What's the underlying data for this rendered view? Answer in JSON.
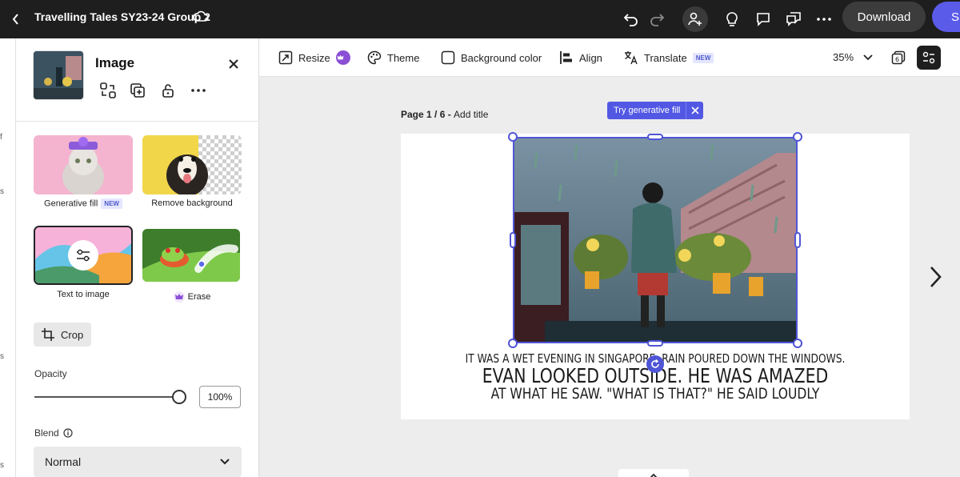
{
  "topbar": {
    "title": "Travelling Tales SY23-24 Group 2",
    "download_label": "Download",
    "share_label": "Share",
    "icons": [
      "back-icon",
      "cloud-icon",
      "undo-icon",
      "redo-icon",
      "add-person-icon",
      "lightbulb-icon",
      "comment-icon",
      "chat-icon",
      "more-icon"
    ]
  },
  "left_strip": [
    "f",
    "s",
    "s",
    "s"
  ],
  "panel": {
    "title": "Image",
    "cards": [
      {
        "label": "Generative fill",
        "badge": "NEW"
      },
      {
        "label": "Remove background"
      },
      {
        "label": "Text to image"
      },
      {
        "label": "Erase"
      }
    ],
    "crop_label": "Crop",
    "opacity_label": "Opacity",
    "opacity_value": "100%",
    "opacity_fraction": 1.0,
    "blend_label": "Blend",
    "blend_value": "Normal"
  },
  "toolbar": {
    "resize": "Resize",
    "theme": "Theme",
    "background": "Background color",
    "align": "Align",
    "translate": "Translate",
    "translate_badge": "NEW",
    "zoom": "35%"
  },
  "canvas": {
    "page_prefix": "Page 1 / 6 - ",
    "page_title_placeholder": "Add title",
    "gen_fill_label": "Try generative fill",
    "story": [
      "IT WAS A WET EVENING IN SINGAPORE. RAIN POURED DOWN THE WINDOWS.",
      "EVAN LOOKED OUTSIDE. HE WAS AMAZED",
      "AT WHAT HE SAW. \"WHAT IS THAT?\" HE SAID LOUDLY"
    ]
  },
  "colors": {
    "topbar": "#1e1e1e",
    "accent": "#5258e4",
    "selection": "#4f55d6",
    "canvas_bg": "#ededed"
  }
}
